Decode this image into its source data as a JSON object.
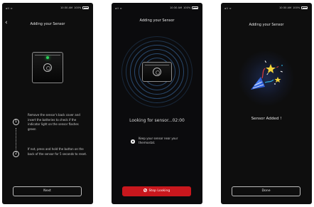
{
  "colors": {
    "background": "#0e0e0e",
    "accent_red": "#c9171d",
    "led_green": "#2bd15a",
    "ring_blue": "#5096e6"
  },
  "status_bar": {
    "signal": "all ≈",
    "time": "10:30 AM",
    "battery": "100%"
  },
  "screens": [
    {
      "title": "Adding your Sensor",
      "back_icon": "chevron-left-icon",
      "steps": [
        {
          "number": "1",
          "text": "Remove the sensor's back cover and insert the batteries to check if the indicator light on the sensor flashes green"
        },
        {
          "number": "2",
          "text": "If not, press and hold the button on the back of the sensor for 5 seconds to reset."
        }
      ],
      "button": "Next"
    },
    {
      "title": "Adding your Sensor",
      "status": "Looking for sensor...02:00",
      "tip_icon": "info-icon",
      "tip": "Keep your sensor near your thermostat.",
      "button": "Stop Looking",
      "button_icon": "stop-icon"
    },
    {
      "title": "Adding your Sensor",
      "illustration": "party-popper-icon",
      "message": "Sensor Added !",
      "button": "Done"
    }
  ]
}
